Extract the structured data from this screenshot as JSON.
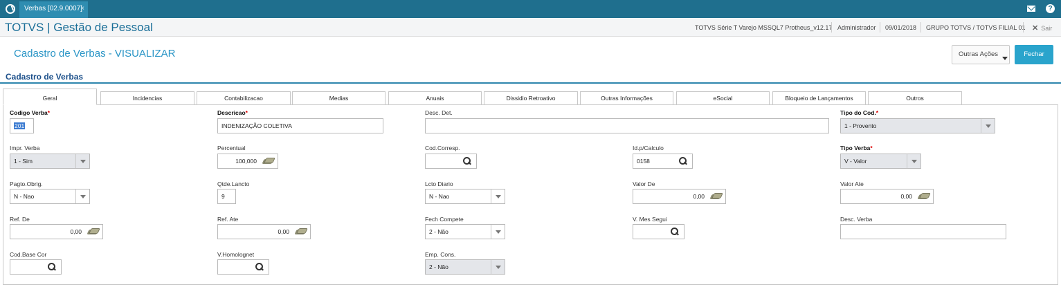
{
  "topbar": {
    "tab_label": "Verbas [02.9.0007]",
    "tab_close": "×"
  },
  "header": {
    "brand": "TOTVS | Gestão de Pessoal",
    "environment": "TOTVS Série T Varejo MSSQL7 Protheus_v12.17",
    "user": "Administrador",
    "date": "09/01/2018",
    "company": "GRUPO TOTVS / TOTVS FILIAL 01",
    "logout": "Sair"
  },
  "page": {
    "title": "Cadastro de Verbas - VISUALIZAR",
    "section_title": "Cadastro de Verbas"
  },
  "actions": {
    "other_actions": "Outras Ações",
    "close": "Fechar"
  },
  "tabs": [
    "Geral",
    "Incidencias",
    "Contabilizacao",
    "Medias",
    "Anuais",
    "Dissidio Retroativo",
    "Outras Informações",
    "eSocial",
    "Bloqueio de Lançamentos",
    "Outros"
  ],
  "active_tab": "Geral",
  "form": {
    "codigo_verba": {
      "label": "Codigo Verba",
      "required": "*",
      "value": "201"
    },
    "descricao": {
      "label": "Descricao",
      "required": "*",
      "value": "INDENIZAÇÃO COLETIVA"
    },
    "desc_det": {
      "label": "Desc. Det.",
      "value": ""
    },
    "tipo_cod": {
      "label": "Tipo do Cod.",
      "required": "*",
      "value": "1 - Provento"
    },
    "impr_verba": {
      "label": "Impr. Verba",
      "value": "1 - Sim"
    },
    "percentual": {
      "label": "Percentual",
      "value": "100,000"
    },
    "cod_corresp": {
      "label": "Cod.Corresp.",
      "value": ""
    },
    "id_calculo": {
      "label": "Id.p/Calculo",
      "value": "0158"
    },
    "tipo_verba": {
      "label": "Tipo Verba",
      "required": "*",
      "value": "V - Valor"
    },
    "pagto_obrig": {
      "label": "Pagto.Obrig.",
      "value": "N - Nao"
    },
    "qtde_lancto": {
      "label": "Qtde.Lancto",
      "value": "9"
    },
    "lcto_diario": {
      "label": "Lcto Diario",
      "value": "N - Nao"
    },
    "valor_de": {
      "label": "Valor De",
      "value": "0,00"
    },
    "valor_ate": {
      "label": "Valor Ate",
      "value": "0,00"
    },
    "ref_de": {
      "label": "Ref. De",
      "value": "0,00"
    },
    "ref_ate": {
      "label": "Ref. Ate",
      "value": "0,00"
    },
    "fech_compete": {
      "label": "Fech Compete",
      "value": "2 - Não"
    },
    "v_mes_segui": {
      "label": "V. Mes Segui",
      "value": ""
    },
    "desc_verba": {
      "label": "Desc. Verba",
      "value": ""
    },
    "cod_base_cor": {
      "label": "Cod.Base Cor",
      "value": ""
    },
    "v_homolognet": {
      "label": "V.Homolognet",
      "value": ""
    },
    "emp_cons": {
      "label": "Emp. Cons.",
      "value": "2 - Não"
    }
  }
}
